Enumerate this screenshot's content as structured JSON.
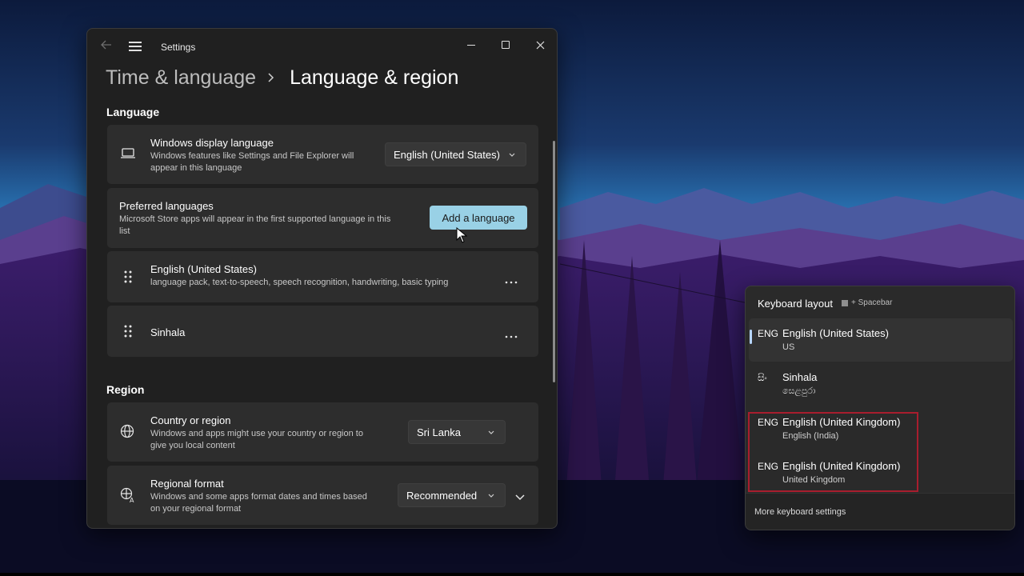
{
  "window": {
    "title": "Settings",
    "breadcrumb_parent": "Time & language",
    "breadcrumb_current": "Language & region"
  },
  "language_section": {
    "title": "Language",
    "display_language": {
      "title": "Windows display language",
      "description_line1": "Windows features like Settings and File Explorer will",
      "description_line2": "appear in this language",
      "value": "English (United States)"
    },
    "preferred": {
      "title": "Preferred languages",
      "description_line1": "Microsoft Store apps will appear in the first supported language in this",
      "description_line2": "list",
      "add_button": "Add a language"
    },
    "languages": [
      {
        "name": "English (United States)",
        "features": "language pack, text-to-speech, speech recognition, handwriting, basic typing"
      },
      {
        "name": "Sinhala",
        "features": ""
      }
    ]
  },
  "region_section": {
    "title": "Region",
    "country": {
      "title": "Country or region",
      "description_line1": "Windows and apps might use your country or region to",
      "description_line2": "give you local content",
      "value": "Sri Lanka"
    },
    "format": {
      "title": "Regional format",
      "description_line1": "Windows and some apps format dates and times based",
      "description_line2": "on your regional format",
      "value": "Recommended"
    }
  },
  "keyboard_flyout": {
    "title": "Keyboard layout",
    "shortcut": "+ Spacebar",
    "items": [
      {
        "code": "ENG",
        "name": "English (United States)",
        "sub": "US",
        "active": true
      },
      {
        "code": "සිං",
        "name": "Sinhala",
        "sub": "සෙළපුරා",
        "active": false
      },
      {
        "code": "ENG",
        "name": "English (United Kingdom)",
        "sub": "English (India)",
        "active": false
      },
      {
        "code": "ENG",
        "name": "English (United Kingdom)",
        "sub": "United Kingdom",
        "active": false
      }
    ],
    "footer": "More keyboard settings"
  },
  "colors": {
    "accent_button": "#99d1e6",
    "highlight_box": "#a81d2e",
    "window_bg": "#202020",
    "card_bg": "#2d2d2d"
  }
}
